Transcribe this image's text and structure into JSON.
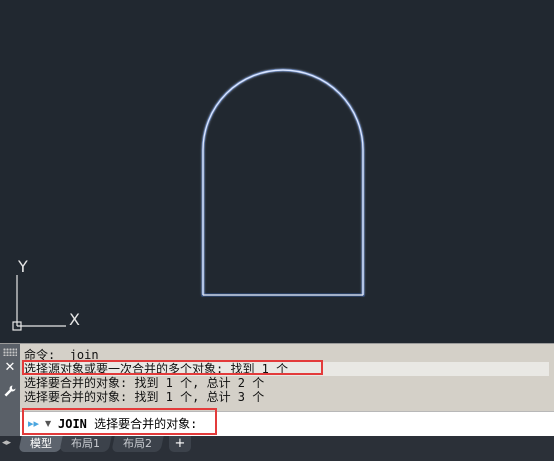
{
  "command_history": [
    "命令:  join",
    "选择源对象或要一次合并的多个对象: 找到 1 个",
    "选择要合并的对象: 找到 1 个, 总计 2 个",
    "选择要合并的对象: 找到 1 个, 总计 3 个"
  ],
  "command_input": {
    "command": "JOIN",
    "prompt": "选择要合并的对象:",
    "value": ""
  },
  "ucs": {
    "y_label": "Y",
    "x_label": "X"
  },
  "layout_tabs": {
    "nav_arrows": "◂▸",
    "tabs": [
      "模型",
      "布局1",
      "布局2"
    ],
    "active": 0,
    "add_label": "+"
  },
  "colors": {
    "canvas_bg": "#212830",
    "shape_stroke": "#dbe6ff",
    "shape_glow": "#3a70d0",
    "highlight": "#e33b3b",
    "command_bg": "#d4d0c8"
  },
  "icons": {
    "close": "close-icon",
    "settings": "wrench-icon",
    "command_arrow": "command-prompt-arrow-icon",
    "dropdown": "chevron-down-icon"
  }
}
